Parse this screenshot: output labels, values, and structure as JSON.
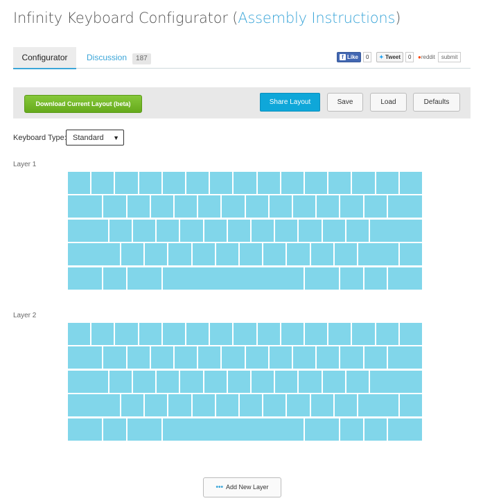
{
  "page": {
    "title_main": "Infinity Keyboard Configurator (",
    "title_link": "Assembly Instructions",
    "title_end": ")"
  },
  "tabs": [
    {
      "label": "Configurator"
    },
    {
      "label": "Discussion",
      "count": "187"
    }
  ],
  "social": {
    "like": "Like",
    "like_count": "0",
    "tweet": "Tweet",
    "tweet_count": "0",
    "reddit": "reddit",
    "submit": "submit"
  },
  "toolbar": {
    "download": "Download Current Layout (beta)",
    "share": "Share Layout",
    "save": "Save",
    "load": "Load",
    "defaults": "Defaults"
  },
  "keyboard_type": {
    "label": "Keyboard Type:",
    "value": "Standard"
  },
  "layers": [
    {
      "label": "Layer 1"
    },
    {
      "label": "Layer 2"
    }
  ],
  "add_layer": {
    "label": "Add New Layer"
  },
  "colors": {
    "key": "#81d6ea",
    "accent": "#3aa5d8",
    "download_green": "#6ab023",
    "share_blue": "#0fa7d9"
  }
}
